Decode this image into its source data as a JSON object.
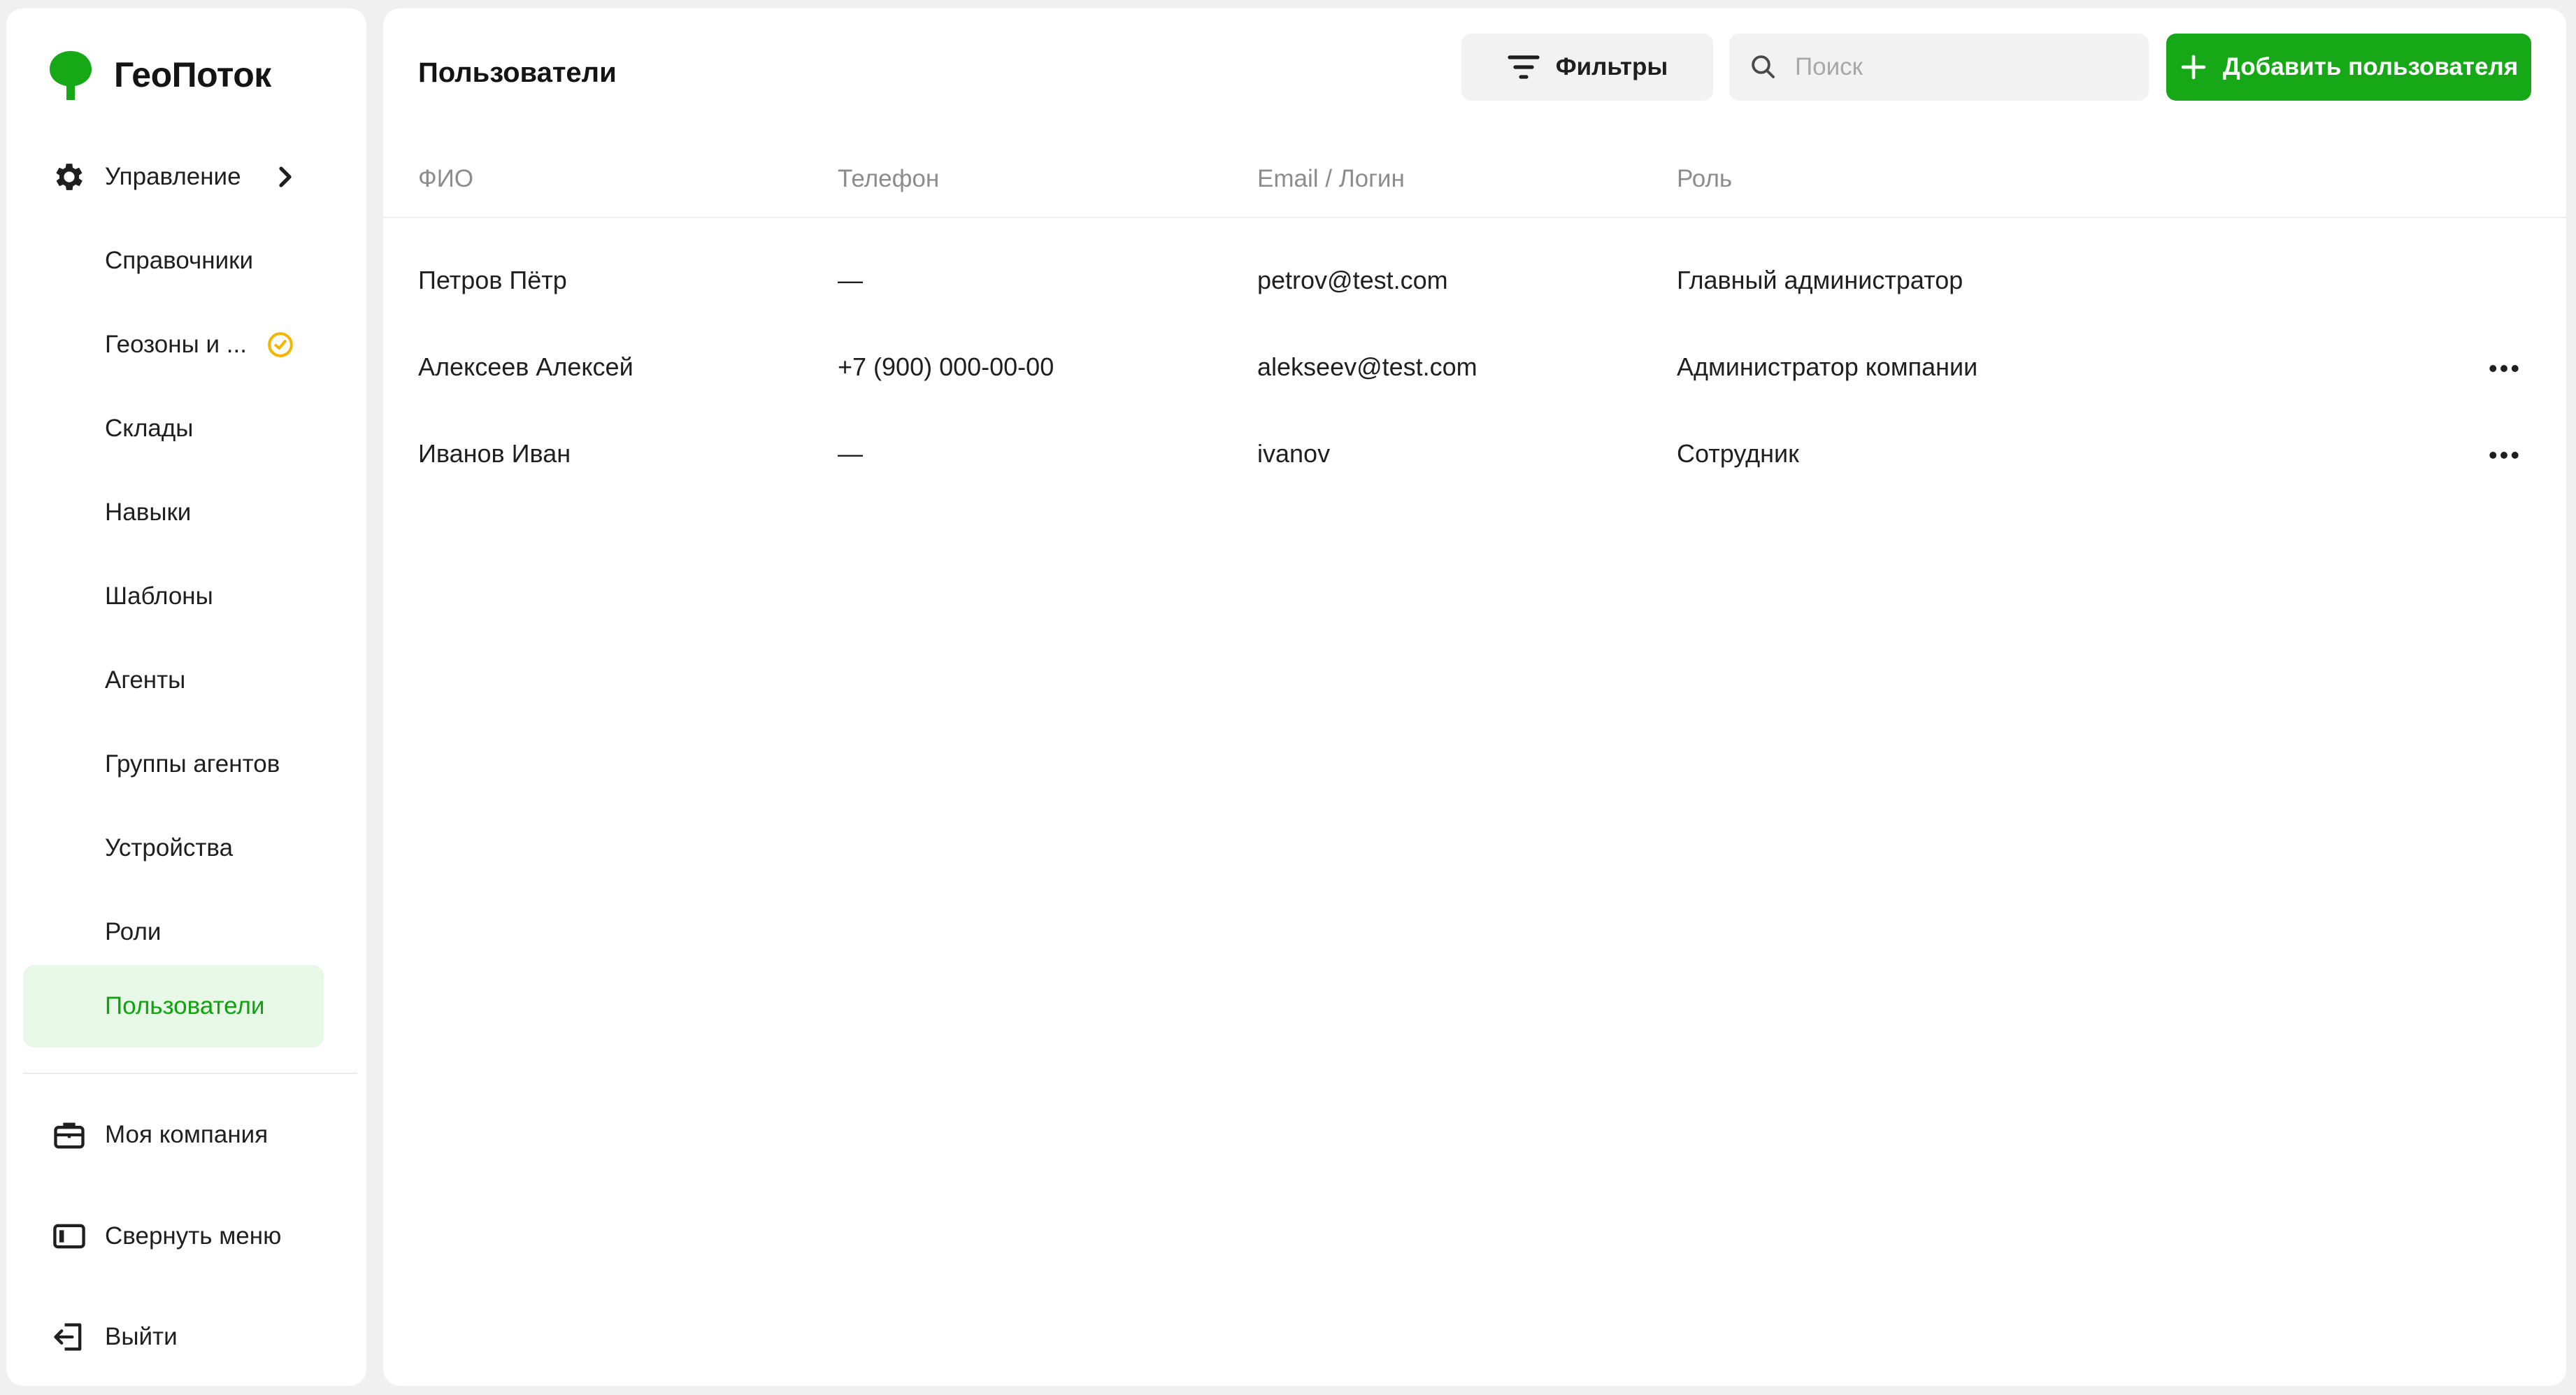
{
  "brand": {
    "name": "ГеоПоток",
    "color": "#17a817"
  },
  "sidebar": {
    "management": {
      "label": "Управление",
      "icon": "gear-icon"
    },
    "items": [
      {
        "label": "Справочники"
      },
      {
        "label": "Геозоны и ...",
        "badge_icon": "clock-icon"
      },
      {
        "label": "Склады"
      },
      {
        "label": "Навыки"
      },
      {
        "label": "Шаблоны"
      },
      {
        "label": "Агенты"
      },
      {
        "label": "Группы агентов"
      },
      {
        "label": "Устройства"
      },
      {
        "label": "Роли"
      },
      {
        "label": "Пользователи",
        "active": true
      }
    ],
    "company": {
      "label": "Моя компания",
      "icon": "briefcase-icon"
    },
    "collapse": {
      "label": "Свернуть меню",
      "icon": "collapse-menu-icon"
    },
    "logout": {
      "label": "Выйти",
      "icon": "logout-icon"
    }
  },
  "main": {
    "title": "Пользователи",
    "filters_label": "Фильтры",
    "search": {
      "placeholder": "Поиск",
      "value": ""
    },
    "add_label": "Добавить пользователя",
    "table": {
      "columns": [
        "ФИО",
        "Телефон",
        "Email / Логин",
        "Роль"
      ],
      "rows": [
        {
          "name": "Петров Пётр",
          "phone": "—",
          "email": "petrov@test.com",
          "role": "Главный администратор",
          "has_menu": false
        },
        {
          "name": "Алексеев Алексей",
          "phone": "+7 (900) 000-00-00",
          "email": "alekseev@test.com",
          "role": "Администратор компании",
          "has_menu": true
        },
        {
          "name": "Иванов Иван",
          "phone": "—",
          "email": "ivanov",
          "role": "Сотрудник",
          "has_menu": true
        }
      ]
    }
  },
  "colors": {
    "accent": "#17a817",
    "active_bg": "#e8f8e6",
    "warning": "#f5b400"
  }
}
